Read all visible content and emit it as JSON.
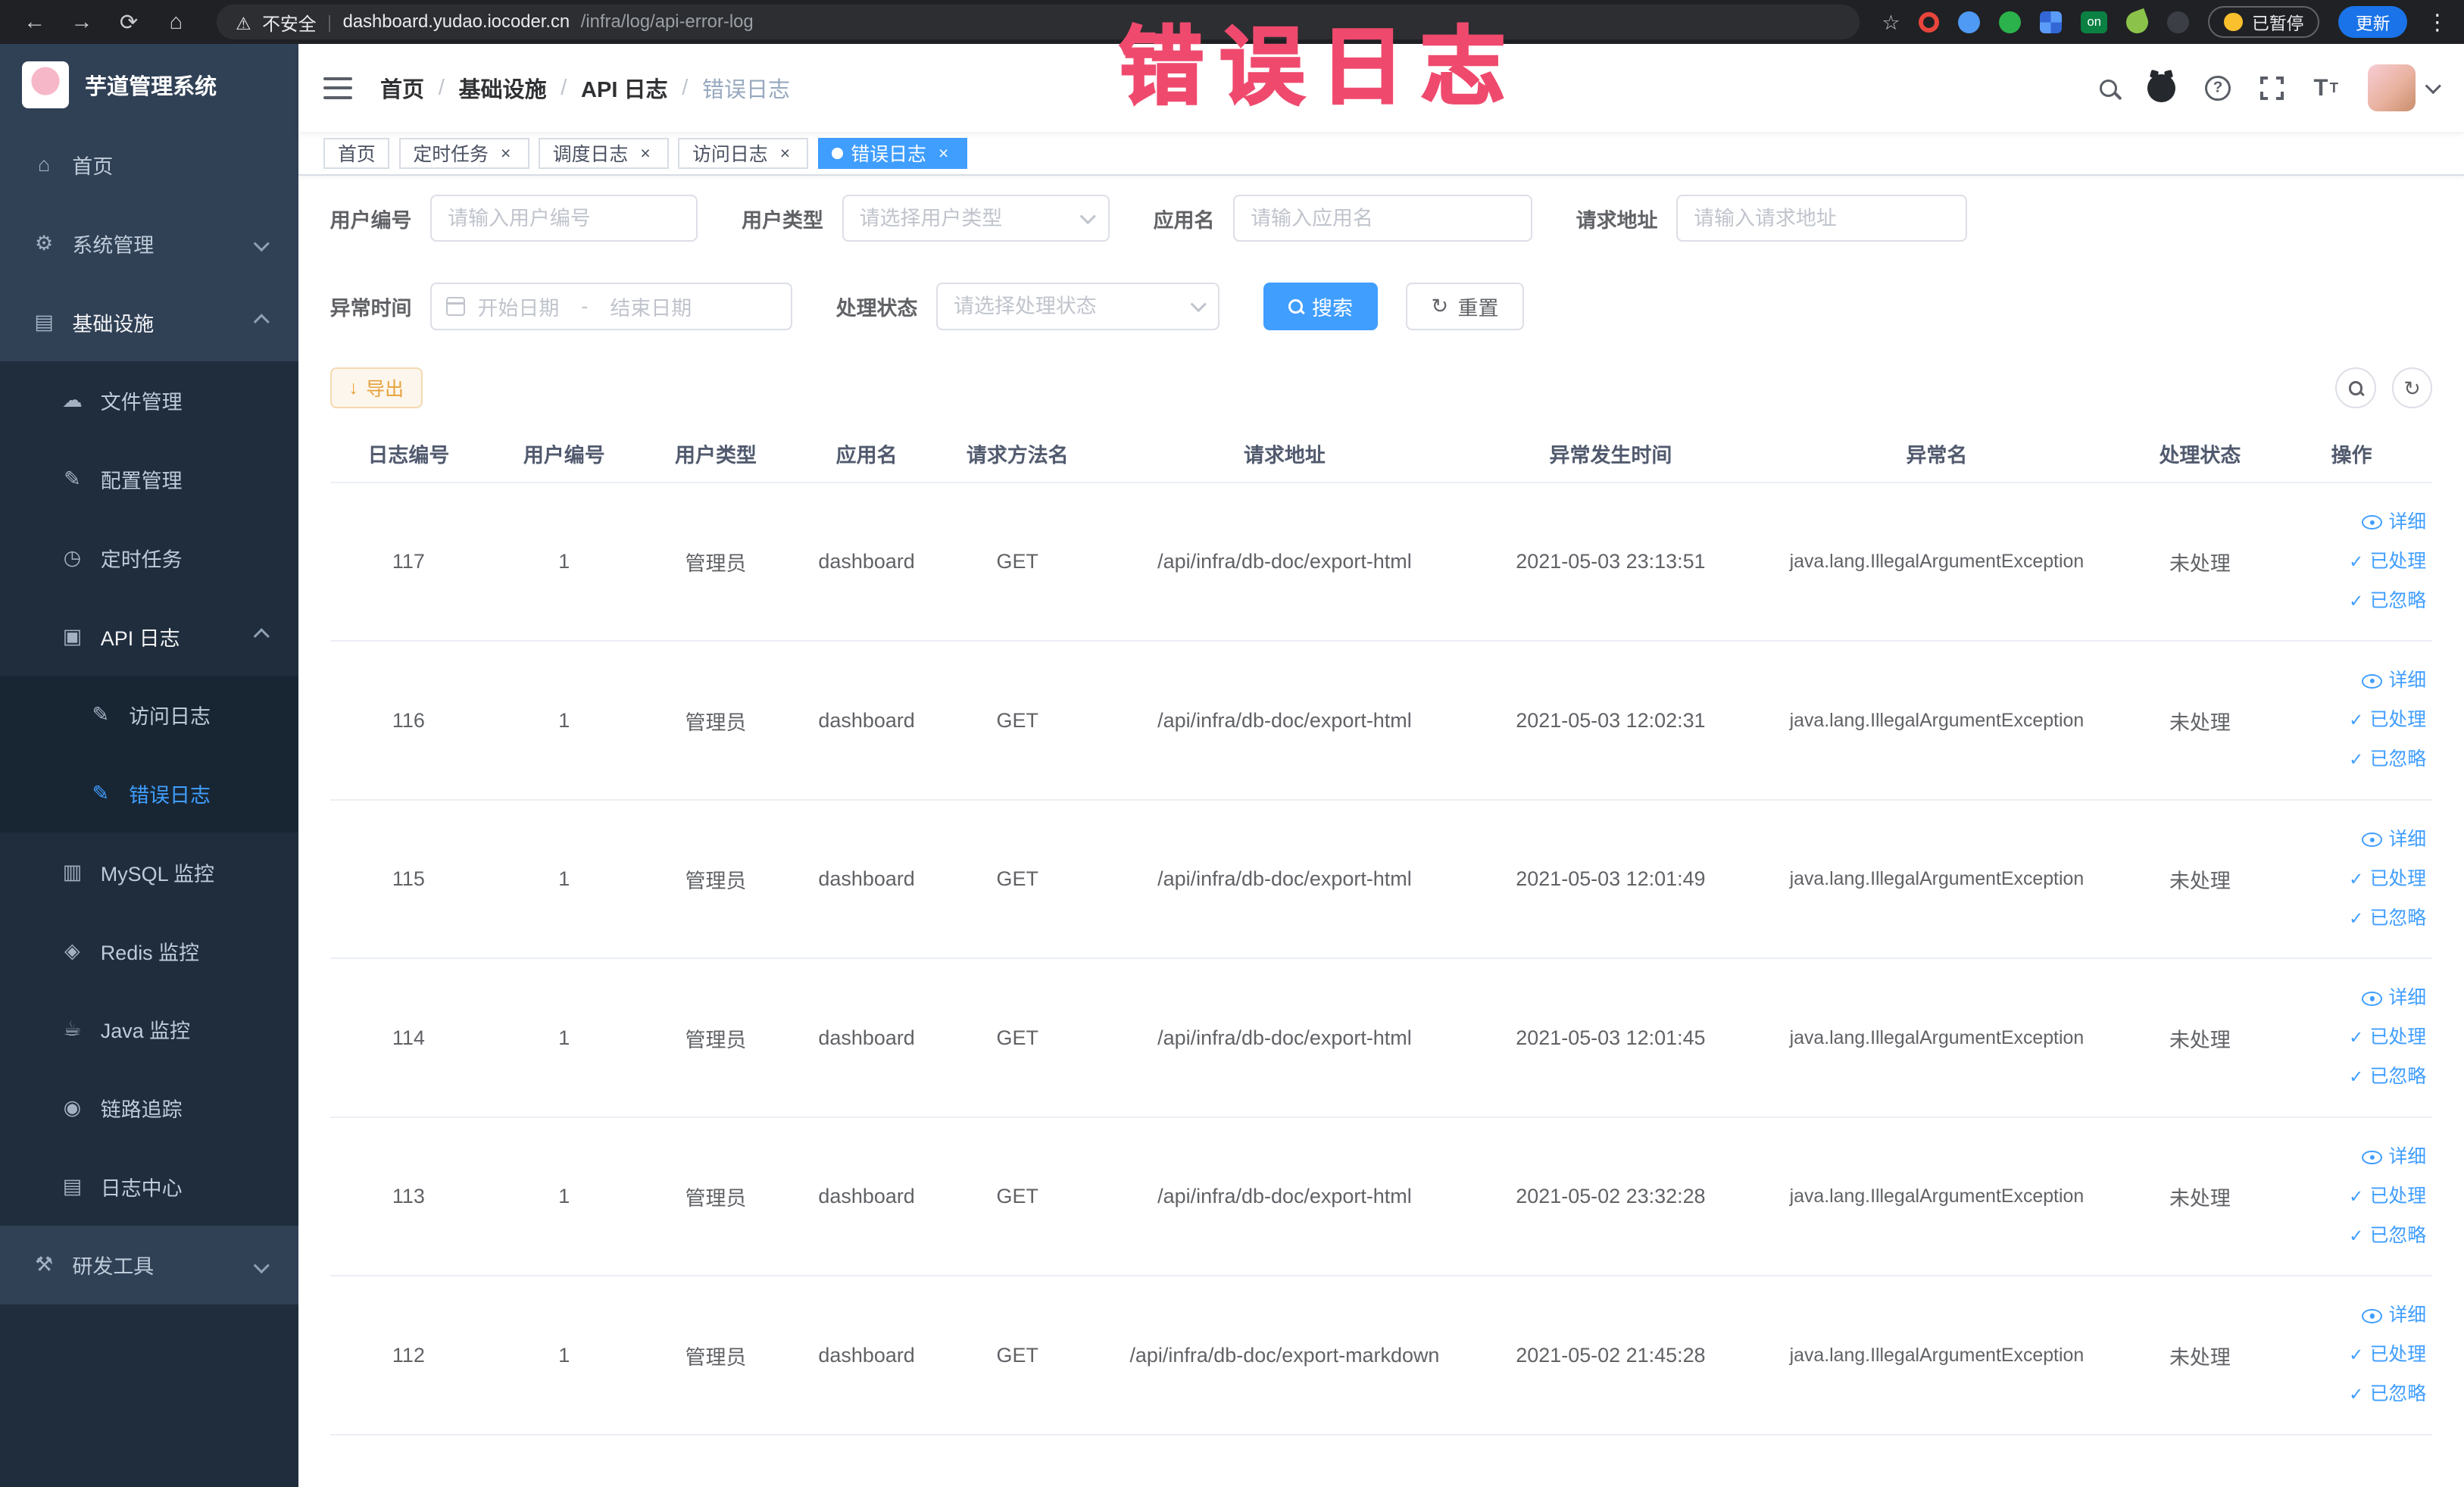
{
  "browser": {
    "security_label": "不安全",
    "url_domain": "dashboard.yudao.iocoder.cn",
    "url_path": "/infra/log/api-error-log",
    "extension_on_badge": "on",
    "paused_badge": "已暂停",
    "update_button": "更新"
  },
  "annotation": {
    "text": "错误日志"
  },
  "sidebar": {
    "logo_title": "芋道管理系统",
    "items": [
      {
        "label": "首页"
      },
      {
        "label": "系统管理"
      },
      {
        "label": "基础设施"
      },
      {
        "label": "文件管理"
      },
      {
        "label": "配置管理"
      },
      {
        "label": "定时任务"
      },
      {
        "label": "API 日志"
      },
      {
        "label": "访问日志"
      },
      {
        "label": "错误日志"
      },
      {
        "label": "MySQL 监控"
      },
      {
        "label": "Redis 监控"
      },
      {
        "label": "Java 监控"
      },
      {
        "label": "链路追踪"
      },
      {
        "label": "日志中心"
      },
      {
        "label": "研发工具"
      }
    ]
  },
  "breadcrumb": {
    "separator": "/",
    "items": [
      "首页",
      "基础设施",
      "API 日志",
      "错误日志"
    ]
  },
  "tabs": [
    {
      "label": "首页"
    },
    {
      "label": "定时任务"
    },
    {
      "label": "调度日志"
    },
    {
      "label": "访问日志"
    },
    {
      "label": "错误日志"
    }
  ],
  "filters": {
    "user_id": {
      "label": "用户编号",
      "placeholder": "请输入用户编号"
    },
    "user_type": {
      "label": "用户类型",
      "placeholder": "请选择用户类型"
    },
    "app_name": {
      "label": "应用名",
      "placeholder": "请输入应用名"
    },
    "request_url": {
      "label": "请求地址",
      "placeholder": "请输入请求地址"
    },
    "exception_time": {
      "label": "异常时间",
      "start_placeholder": "开始日期",
      "separator": "-",
      "end_placeholder": "结束日期"
    },
    "process_status": {
      "label": "处理状态",
      "placeholder": "请选择处理状态"
    },
    "search_button": "搜索",
    "reset_button": "重置"
  },
  "toolbar": {
    "export_button": "导出"
  },
  "table": {
    "columns": [
      "日志编号",
      "用户编号",
      "用户类型",
      "应用名",
      "请求方法名",
      "请求地址",
      "异常发生时间",
      "异常名",
      "处理状态",
      "操作"
    ],
    "action_labels": [
      "详细",
      "已处理",
      "已忽略"
    ],
    "rows": [
      {
        "id": "117",
        "user_id": "1",
        "user_type": "管理员",
        "app": "dashboard",
        "method": "GET",
        "url": "/api/infra/db-doc/export-html",
        "time": "2021-05-03 23:13:51",
        "exception": "java.lang.IllegalArgumentException",
        "status": "未处理"
      },
      {
        "id": "116",
        "user_id": "1",
        "user_type": "管理员",
        "app": "dashboard",
        "method": "GET",
        "url": "/api/infra/db-doc/export-html",
        "time": "2021-05-03 12:02:31",
        "exception": "java.lang.IllegalArgumentException",
        "status": "未处理"
      },
      {
        "id": "115",
        "user_id": "1",
        "user_type": "管理员",
        "app": "dashboard",
        "method": "GET",
        "url": "/api/infra/db-doc/export-html",
        "time": "2021-05-03 12:01:49",
        "exception": "java.lang.IllegalArgumentException",
        "status": "未处理"
      },
      {
        "id": "114",
        "user_id": "1",
        "user_type": "管理员",
        "app": "dashboard",
        "method": "GET",
        "url": "/api/infra/db-doc/export-html",
        "time": "2021-05-03 12:01:45",
        "exception": "java.lang.IllegalArgumentException",
        "status": "未处理"
      },
      {
        "id": "113",
        "user_id": "1",
        "user_type": "管理员",
        "app": "dashboard",
        "method": "GET",
        "url": "/api/infra/db-doc/export-html",
        "time": "2021-05-02 23:32:28",
        "exception": "java.lang.IllegalArgumentException",
        "status": "未处理"
      },
      {
        "id": "112",
        "user_id": "1",
        "user_type": "管理员",
        "app": "dashboard",
        "method": "GET",
        "url": "/api/infra/db-doc/export-markdown",
        "time": "2021-05-02 21:45:28",
        "exception": "java.lang.IllegalArgumentException",
        "status": "未处理"
      }
    ]
  }
}
